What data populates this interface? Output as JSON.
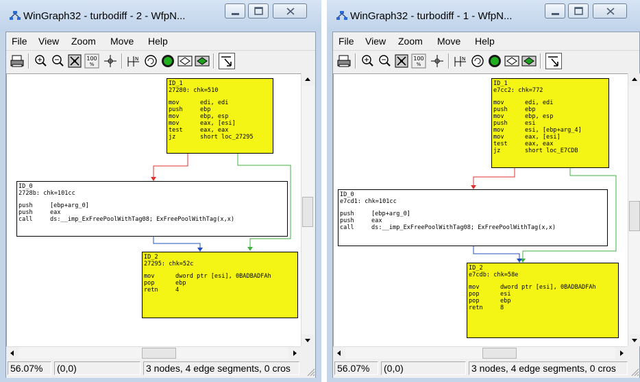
{
  "windows": [
    {
      "title": "WinGraph32 - turbodiff - 2 - WfpN...",
      "menu": [
        "File",
        "View",
        "Zoom",
        "Move",
        "Help"
      ],
      "status": {
        "zoom": "56.07%",
        "coords": "(0,0)",
        "info": "3 nodes, 4 edge segments, 0 cros"
      },
      "nodes": {
        "a": {
          "header": [
            "ID_1",
            "27280: chk=510"
          ],
          "ins": [
            [
              "mov",
              "edi, edi"
            ],
            [
              "push",
              "ebp"
            ],
            [
              "mov",
              "ebp, esp"
            ],
            [
              "mov",
              "eax, [esi]"
            ],
            [
              "test",
              "eax, eax"
            ],
            [
              "jz",
              "short loc_27295"
            ]
          ]
        },
        "b": {
          "header": [
            "ID_0",
            "2728b: chk=101cc"
          ],
          "ins": [
            [
              "push",
              "[ebp+arg_0]"
            ],
            [
              "push",
              "eax"
            ],
            [
              "call",
              "ds:__imp_ExFreePoolWithTag08; ExFreePoolWithTag(x,x)"
            ]
          ]
        },
        "c": {
          "header": [
            "ID_2",
            "27295: chk=52c"
          ],
          "ins": [
            [
              "mov",
              "dword ptr [esi], 0BADBADFAh"
            ],
            [
              "pop",
              "ebp"
            ],
            [
              "retn",
              "4"
            ]
          ]
        }
      }
    },
    {
      "title": "WinGraph32 - turbodiff - 1 - WfpN...",
      "menu": [
        "File",
        "View",
        "Zoom",
        "Move",
        "Help"
      ],
      "status": {
        "zoom": "56.07%",
        "coords": "(0,0)",
        "info": "3 nodes, 4 edge segments, 0 cros"
      },
      "nodes": {
        "a": {
          "header": [
            "ID_1",
            "e7cc2: chk=772"
          ],
          "ins": [
            [
              "mov",
              "edi, edi"
            ],
            [
              "push",
              "ebp"
            ],
            [
              "mov",
              "ebp, esp"
            ],
            [
              "push",
              "esi"
            ],
            [
              "mov",
              "esi, [ebp+arg_4]"
            ],
            [
              "mov",
              "eax, [esi]"
            ],
            [
              "test",
              "eax, eax"
            ],
            [
              "jz",
              "short loc_E7CDB"
            ]
          ]
        },
        "b": {
          "header": [
            "ID_0",
            "e7cd1: chk=101cc"
          ],
          "ins": [
            [
              "push",
              "[ebp+arg_0]"
            ],
            [
              "push",
              "eax"
            ],
            [
              "call",
              "ds:__imp_ExFreePoolWithTag08; ExFreePoolWithTag(x,x)"
            ]
          ]
        },
        "c": {
          "header": [
            "ID_2",
            "e7cdb: chk=58e"
          ],
          "ins": [
            [
              "mov",
              "dword ptr [esi], 0BADBADFAh"
            ],
            [
              "pop",
              "esi"
            ],
            [
              "pop",
              "ebp"
            ],
            [
              "retn",
              "8"
            ]
          ]
        }
      }
    }
  ],
  "colors": {
    "node_yellow": "#f5f515",
    "edge_false": "#e03030",
    "edge_true": "#40b040",
    "edge_uncond": "#2050c0"
  },
  "toolbar_icons": [
    "print-icon",
    "zoom-in-icon",
    "zoom-out-icon",
    "fit-icon",
    "zoom-100-icon",
    "center-icon",
    "position-icon",
    "rotate-icon",
    "globe-icon",
    "view-icon",
    "node-icon",
    "follow-edge-icon"
  ]
}
